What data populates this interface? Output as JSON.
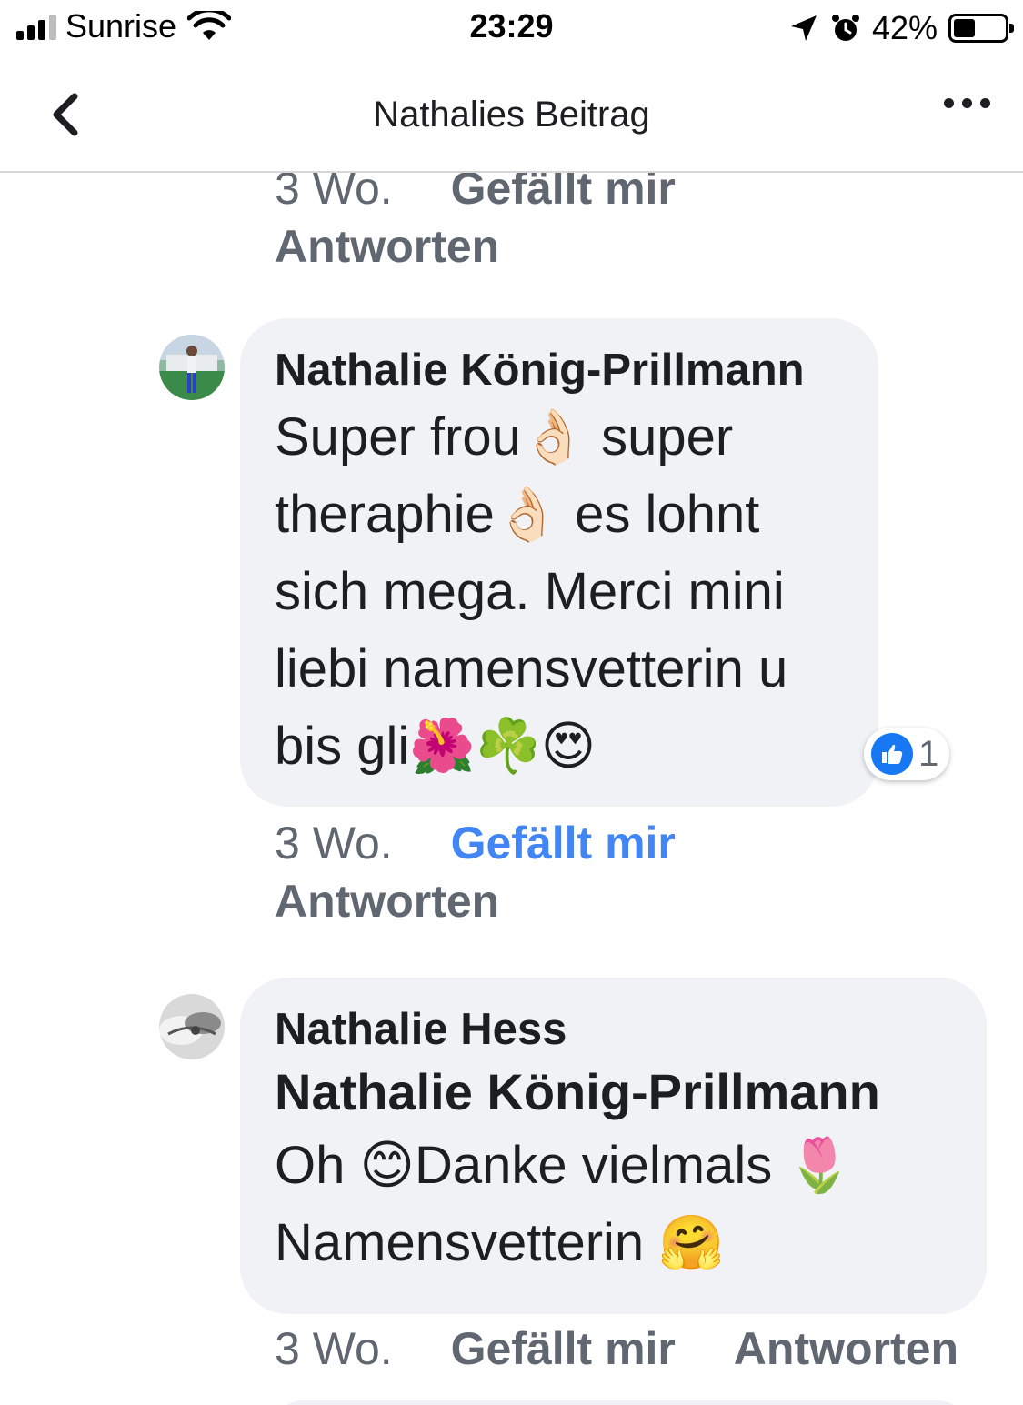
{
  "status_bar": {
    "carrier": "Sunrise",
    "time": "23:29",
    "battery": "42%",
    "battery_level": 0.42
  },
  "nav": {
    "title": "Nathalies Beitrag",
    "back_icon": "chevron-left-icon",
    "more_icon": "more-dots-icon"
  },
  "colors": {
    "bubble": "#f0f2f5",
    "like_active": "#4285f4",
    "meta_text": "#606770",
    "like_badge": "#1877f2"
  },
  "top_actions": {
    "time": "3 Wo.",
    "like": "Gefällt mir",
    "reply": "Antworten"
  },
  "comments": [
    {
      "author": "Nathalie König-Prillmann",
      "lines": [
        "Super frou👌🏻 super",
        "theraphie👌🏻 es lohnt",
        "sich mega. Merci mini",
        "liebi namensvetterin u",
        "bis gli🌺☘️😍"
      ],
      "reactions": "1",
      "actions": {
        "time": "3 Wo.",
        "like": "Gefällt mir",
        "reply": "Antworten"
      }
    },
    {
      "author": "Nathalie Hess",
      "tag": "Nathalie König-Prillmann",
      "lines": [
        "Oh 😊Danke vielmals 🌷",
        "Namensvetterin 🤗"
      ],
      "actions": {
        "time": "3 Wo.",
        "like": "Gefällt mir",
        "reply": "Antworten"
      }
    }
  ]
}
